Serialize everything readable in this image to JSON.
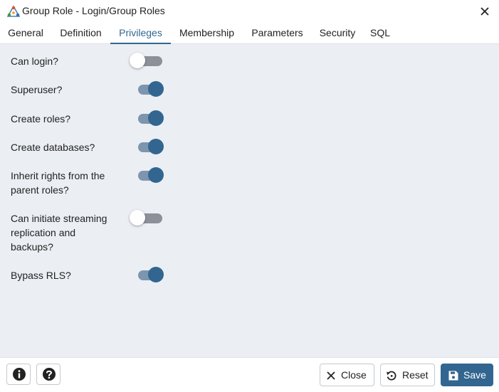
{
  "window": {
    "title": "Group Role - Login/Group Roles",
    "close_icon": "close-icon"
  },
  "tabs": [
    {
      "label": "General",
      "active": false
    },
    {
      "label": "Definition",
      "active": false
    },
    {
      "label": "Privileges",
      "active": true
    },
    {
      "label": "Membership",
      "active": false
    },
    {
      "label": "Parameters",
      "active": false
    },
    {
      "label": "Security",
      "active": false
    },
    {
      "label": "SQL",
      "active": false
    }
  ],
  "privileges": [
    {
      "label": "Can login?",
      "enabled": false
    },
    {
      "label": "Superuser?",
      "enabled": true
    },
    {
      "label": "Create roles?",
      "enabled": true
    },
    {
      "label": "Create databases?",
      "enabled": true
    },
    {
      "label": "Inherit rights from the parent roles?",
      "enabled": true
    },
    {
      "label": "Can initiate streaming replication and backups?",
      "enabled": false
    },
    {
      "label": "Bypass RLS?",
      "enabled": true
    }
  ],
  "footer": {
    "info_icon": "info-icon",
    "help_icon": "help-icon",
    "close_label": "Close",
    "reset_label": "Reset",
    "save_label": "Save"
  },
  "colors": {
    "accent": "#326690",
    "content_bg": "#ebeef3",
    "switch_on_track": "#7d95ae",
    "switch_off_track": "#8d9099"
  }
}
